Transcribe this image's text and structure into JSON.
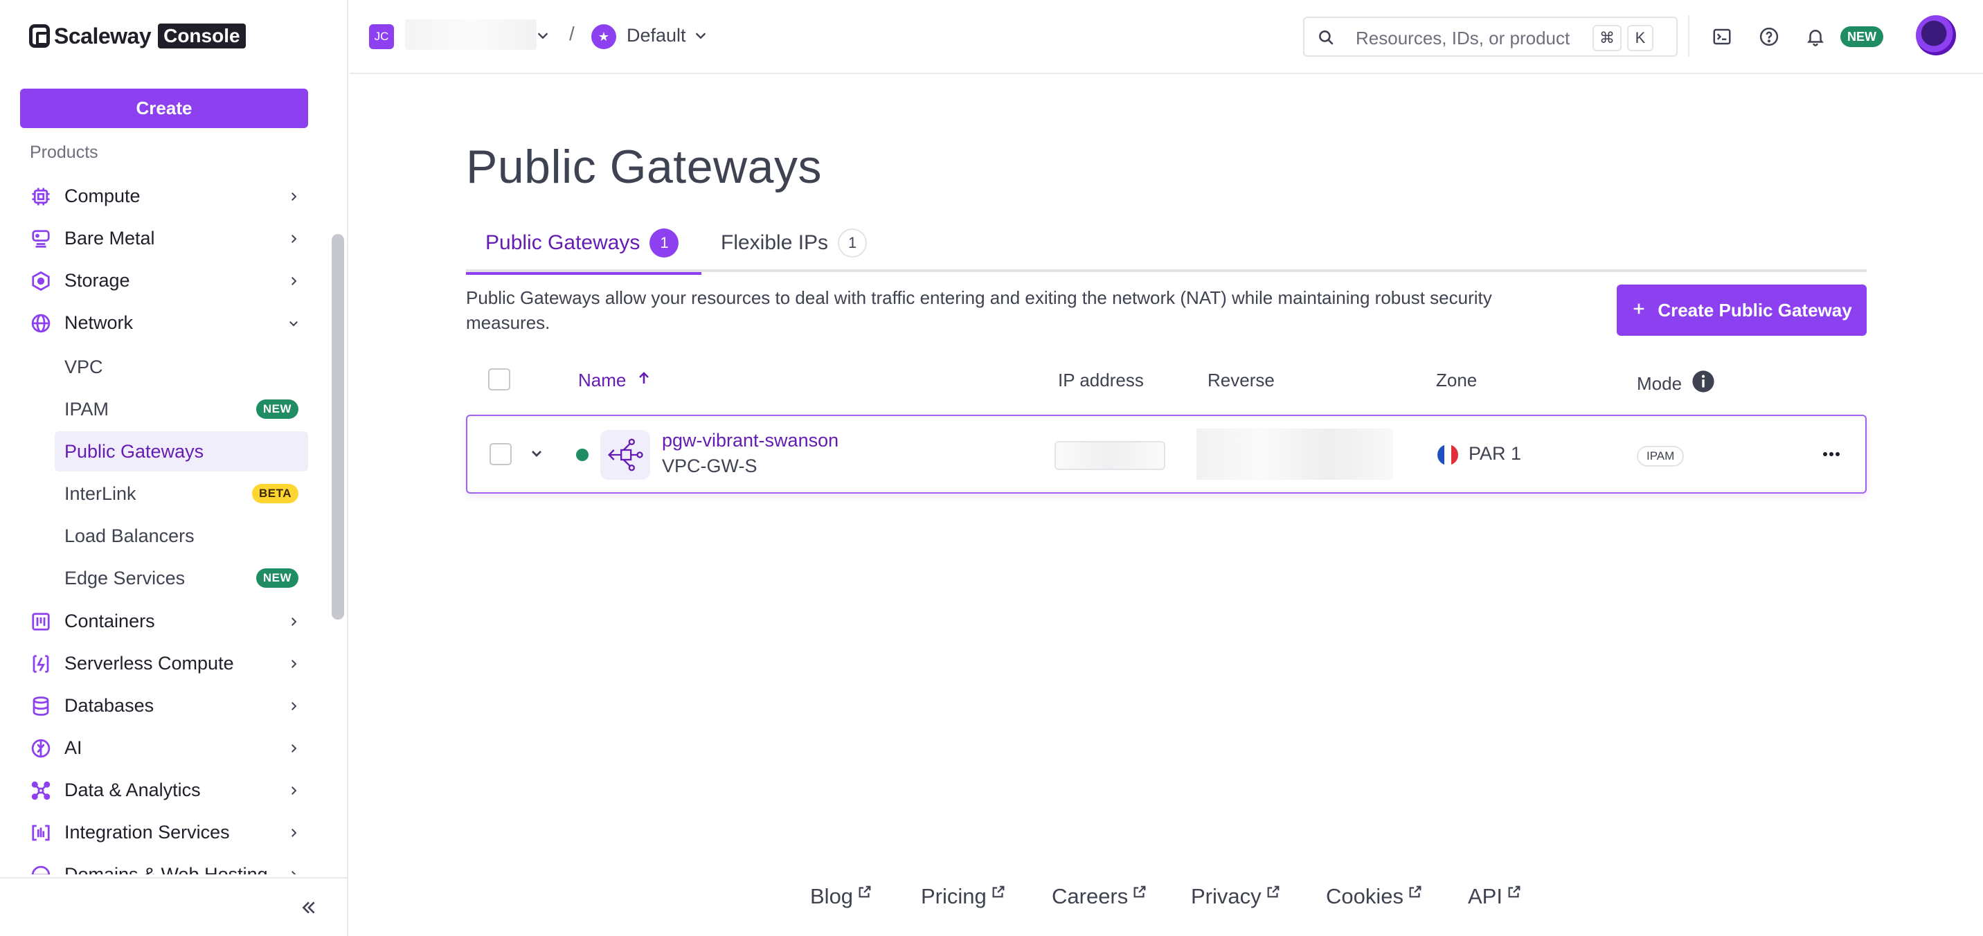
{
  "logo": {
    "word": "Scaleway",
    "badge": "Console"
  },
  "sidebar": {
    "create_label": "Create",
    "products_label": "Products",
    "items": [
      {
        "label": "Compute",
        "icon": "cpu-icon",
        "expanded": false
      },
      {
        "label": "Bare Metal",
        "icon": "server-icon",
        "expanded": false
      },
      {
        "label": "Storage",
        "icon": "hexagon-storage-icon",
        "expanded": false
      },
      {
        "label": "Network",
        "icon": "globe-icon",
        "expanded": true
      },
      {
        "label": "Containers",
        "icon": "container-icon",
        "expanded": false
      },
      {
        "label": "Serverless Compute",
        "icon": "serverless-icon",
        "expanded": false
      },
      {
        "label": "Databases",
        "icon": "database-icon",
        "expanded": false
      },
      {
        "label": "AI",
        "icon": "brain-icon",
        "expanded": false
      },
      {
        "label": "Data & Analytics",
        "icon": "analytics-icon",
        "expanded": false
      },
      {
        "label": "Integration Services",
        "icon": "integration-icon",
        "expanded": false
      },
      {
        "label": "Domains & Web Hosting",
        "icon": "web-icon",
        "expanded": false
      }
    ],
    "network_sub": [
      {
        "label": "VPC",
        "badge": ""
      },
      {
        "label": "IPAM",
        "badge": "NEW"
      },
      {
        "label": "Public Gateways",
        "badge": "",
        "active": true
      },
      {
        "label": "InterLink",
        "badge": "BETA"
      },
      {
        "label": "Load Balancers",
        "badge": ""
      },
      {
        "label": "Edge Services",
        "badge": "NEW"
      }
    ]
  },
  "topbar": {
    "org_initials": "JC",
    "project_icon": "★",
    "project_name": "Default",
    "search_placeholder": "Resources, IDs, or product",
    "shortcut_keys": [
      "⌘",
      "K"
    ],
    "new_badge": "NEW"
  },
  "main": {
    "title": "Public Gateways",
    "tabs": [
      {
        "label": "Public Gateways",
        "count": "1",
        "active": true
      },
      {
        "label": "Flexible IPs",
        "count": "1",
        "active": false
      }
    ],
    "description": "Public Gateways allow your resources to deal with traffic entering and exiting the network (NAT) while maintaining robust security measures.",
    "create_button": "Create Public Gateway",
    "columns": {
      "name": "Name",
      "ip": "IP address",
      "reverse": "Reverse",
      "zone": "Zone",
      "mode": "Mode"
    },
    "rows": [
      {
        "name": "pgw-vibrant-swanson",
        "type": "VPC-GW-S",
        "zone": "PAR 1",
        "mode": "IPAM",
        "status": "running"
      }
    ]
  },
  "footer": {
    "links": [
      "Blog",
      "Pricing",
      "Careers",
      "Privacy",
      "Cookies",
      "API"
    ]
  },
  "colors": {
    "accent": "#8c40ef",
    "accent_text": "#641cb3",
    "status_green": "#1f8c64",
    "beta_yellow": "#ffd531"
  }
}
